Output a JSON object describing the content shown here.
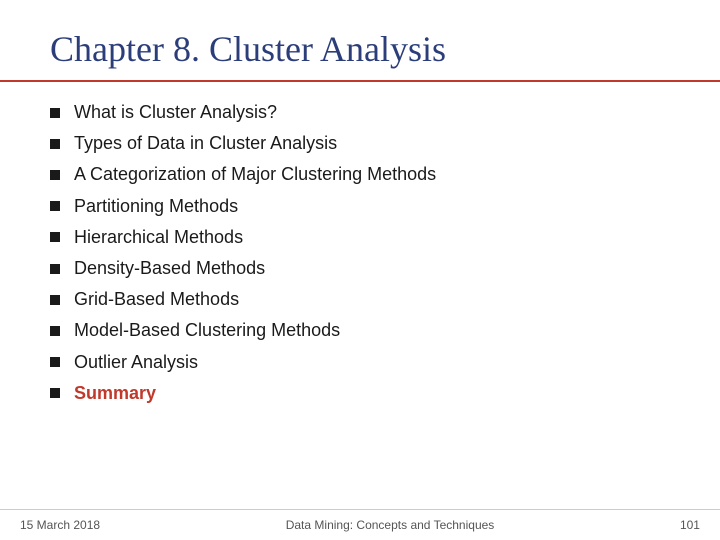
{
  "slide": {
    "title": "Chapter 8. Cluster Analysis",
    "bullets": [
      {
        "id": 1,
        "text": "What is Cluster Analysis?",
        "isSummary": false
      },
      {
        "id": 2,
        "text": "Types of Data in Cluster Analysis",
        "isSummary": false
      },
      {
        "id": 3,
        "text": "A Categorization of Major Clustering Methods",
        "isSummary": false
      },
      {
        "id": 4,
        "text": "Partitioning Methods",
        "isSummary": false
      },
      {
        "id": 5,
        "text": "Hierarchical Methods",
        "isSummary": false
      },
      {
        "id": 6,
        "text": "Density-Based Methods",
        "isSummary": false
      },
      {
        "id": 7,
        "text": "Grid-Based Methods",
        "isSummary": false
      },
      {
        "id": 8,
        "text": "Model-Based Clustering Methods",
        "isSummary": false
      },
      {
        "id": 9,
        "text": "Outlier Analysis",
        "isSummary": false
      },
      {
        "id": 10,
        "text": "Summary",
        "isSummary": true
      }
    ],
    "footer": {
      "date": "15 March 2018",
      "course": "Data Mining: Concepts and Techniques",
      "page": "101"
    }
  },
  "colors": {
    "title": "#2c3e7a",
    "accent": "#c0392b",
    "text": "#1a1a1a",
    "summary": "#c0392b"
  }
}
